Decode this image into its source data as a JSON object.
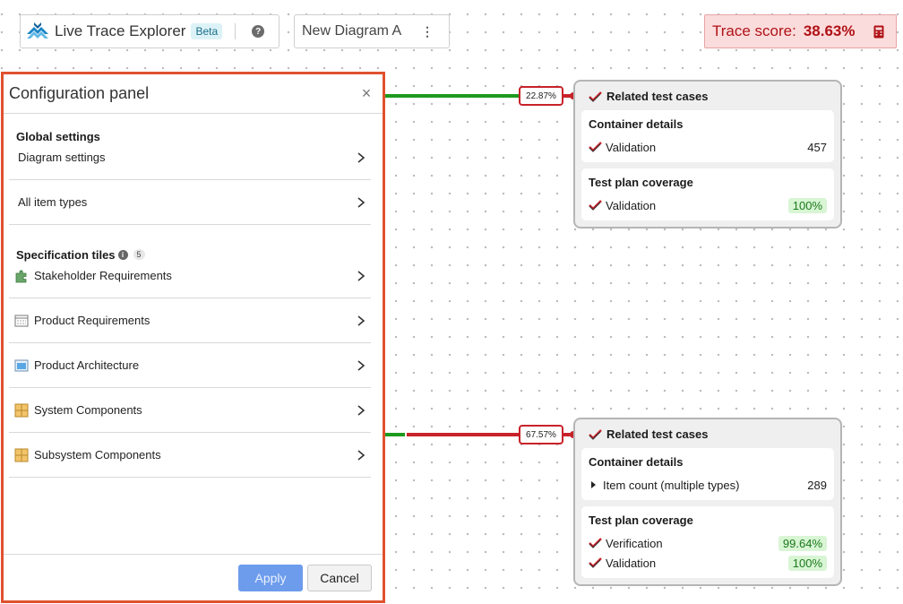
{
  "header": {
    "app_title": "Live Trace Explorer",
    "badge": "Beta",
    "help_icon": "question-circle-icon",
    "logo_icon": "layered-peaks-logo",
    "accent": "#1a86c7"
  },
  "diagram": {
    "name": "New Diagram A",
    "menu_glyph": "⋮"
  },
  "trace_score": {
    "label": "Trace score:",
    "value": "38.63%",
    "icon": "calculator-icon",
    "color": "#b01217"
  },
  "connectors": [
    {
      "percent": "22.87%"
    },
    {
      "percent": "67.57%"
    }
  ],
  "tiles": [
    {
      "title": "Related test cases",
      "sections": [
        {
          "title": "Container details",
          "rows": [
            {
              "label": "Validation",
              "value": "457"
            }
          ]
        },
        {
          "title": "Test plan coverage",
          "rows": [
            {
              "label": "Validation",
              "value": "100%"
            }
          ]
        }
      ]
    },
    {
      "title": "Related test cases",
      "sections": [
        {
          "title": "Container details",
          "rows": [
            {
              "label": "Item count (multiple types)",
              "value": "289"
            }
          ]
        },
        {
          "title": "Test plan coverage",
          "rows": [
            {
              "label": "Verification",
              "value": "99.64%"
            },
            {
              "label": "Validation",
              "value": "100%"
            }
          ]
        }
      ]
    }
  ],
  "config_panel": {
    "title": "Configuration panel",
    "close_glyph": "×",
    "global_heading": "Global settings",
    "global_items": [
      {
        "label": "Diagram settings"
      },
      {
        "label": "All item types"
      }
    ],
    "spec_heading": "Specification tiles",
    "spec_count": "5",
    "spec_items": [
      {
        "label": "Stakeholder Requirements",
        "icon": "puzzle-icon"
      },
      {
        "label": "Product Requirements",
        "icon": "document-grid-icon"
      },
      {
        "label": "Product Architecture",
        "icon": "window-blue-icon"
      },
      {
        "label": "System Components",
        "icon": "component-grid-icon"
      },
      {
        "label": "Subsystem Components",
        "icon": "component-grid-icon"
      }
    ],
    "apply_label": "Apply",
    "cancel_label": "Cancel"
  },
  "colors": {
    "panel_border": "#e0512e",
    "connector_green": "#1e9a1e",
    "connector_red": "#c8222a",
    "good_bg": "#d8f5d4"
  }
}
